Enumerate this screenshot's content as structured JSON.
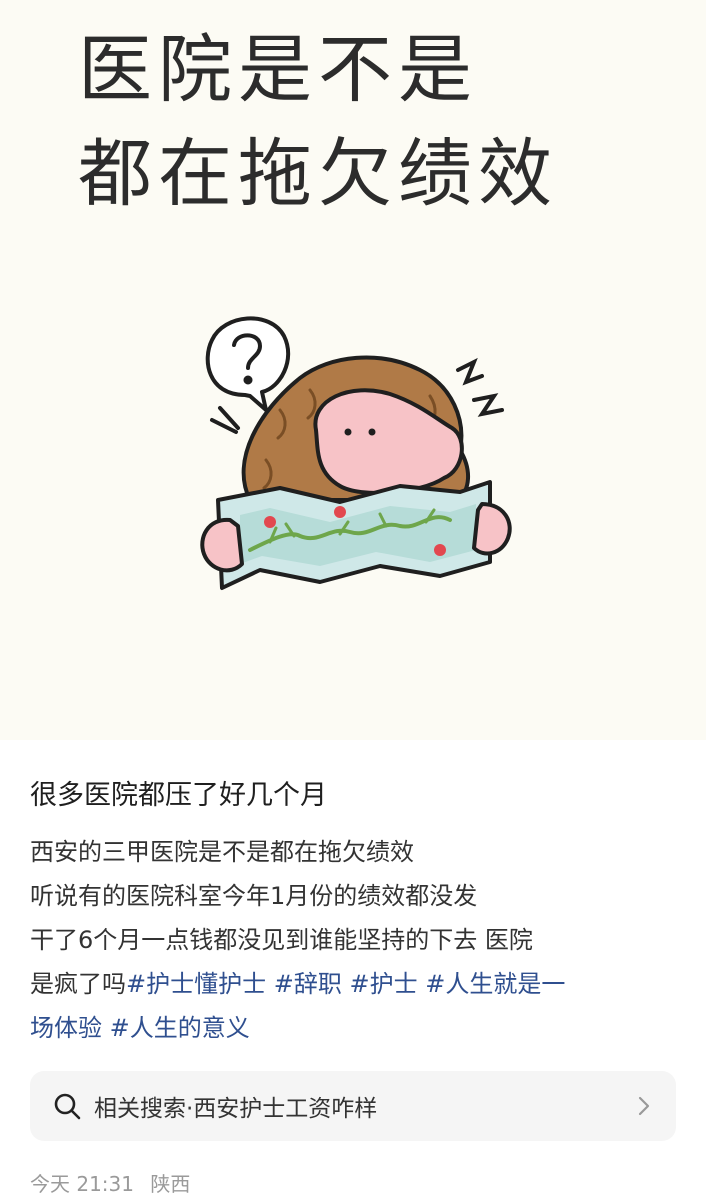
{
  "cover": {
    "title_line1": "医院是不是",
    "title_line2": "都在拖欠绩效",
    "illustration_icon": "confused-girl-reading-map-illustration"
  },
  "post": {
    "title": "很多医院都压了好几个月",
    "body_line1": "西安的三甲医院是不是都在拖欠绩效",
    "body_line2": "听说有的医院科室今年1月份的绩效都没发",
    "body_line3": "干了6个月一点钱都没见到谁能坚持的下去 医院",
    "body_line4_prefix": "是疯了吗",
    "tags": [
      "#护士懂护士",
      "#辞职",
      "#护士",
      "#人生就是一场体验",
      "#人生的意义"
    ],
    "tag_line4": [
      "#护士懂护士",
      "#辞职",
      "#护士",
      "#人生就是一"
    ],
    "tag_line5_prefix": "场体验",
    "tag_line5_rest": "#人生的意义"
  },
  "related_search": {
    "label": "相关搜索·西安护士工资咋样",
    "icon": "search-icon",
    "chevron": "chevron-right-icon"
  },
  "meta": {
    "time": "今天 21:31",
    "location": "陕西"
  },
  "colors": {
    "cover_bg": "#fcfbf4",
    "tag": "#2f4f8f",
    "meta": "#9a9a9a"
  }
}
